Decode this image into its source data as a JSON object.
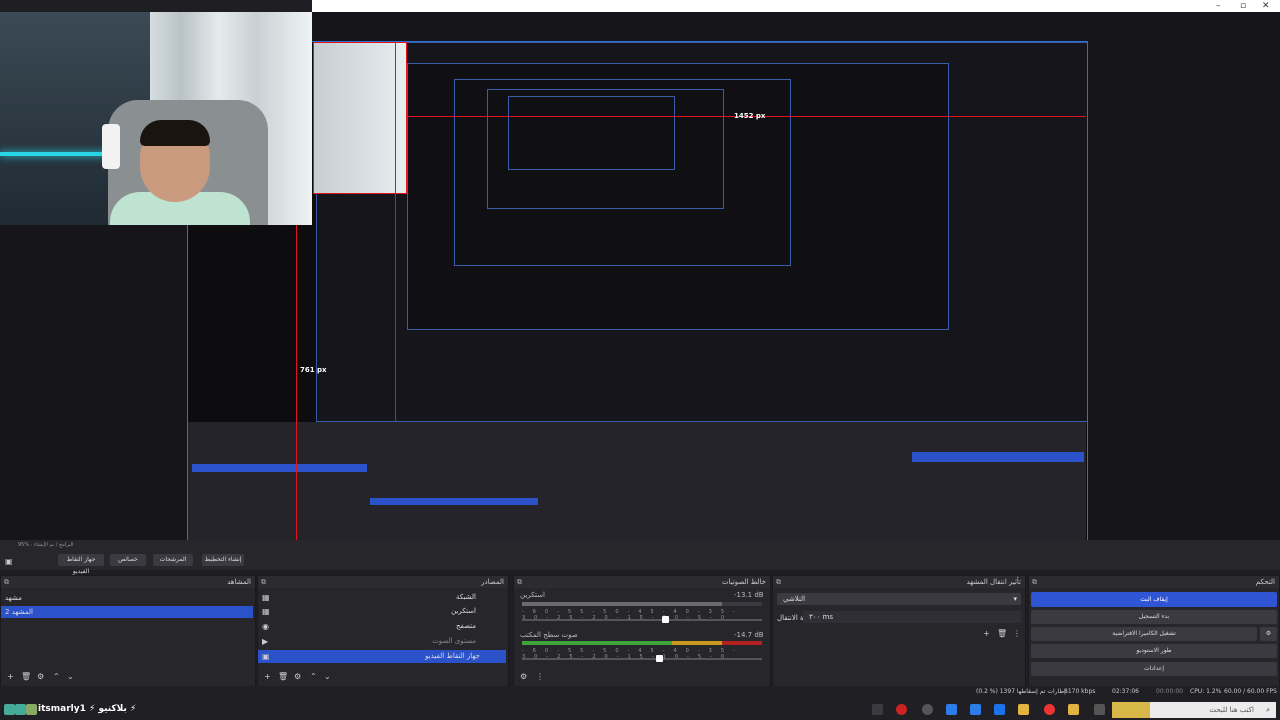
{
  "window": {
    "minimize": "–",
    "maximize": "▫",
    "close": "✕"
  },
  "preview": {
    "label_1452": "1452 px",
    "label_761": "761 px",
    "label_1452_b": "1452 px"
  },
  "topbar": {
    "version": "95% · البرامج / تم الإنشاء",
    "buttons": [
      "جهاز التقاط الفيديو",
      "خصائص",
      "المرشحات",
      "إنشاء التخطيط"
    ]
  },
  "docks": {
    "scenes": {
      "title": "المشاهد",
      "items": [
        "مشهد",
        "المشهد 2"
      ],
      "selected_index": 1
    },
    "sources": {
      "title": "المصادر",
      "items": [
        "الشبكة",
        "استكرين",
        "متصفح",
        "مستوى الصوت",
        "جهاز التقاط الفيديو"
      ],
      "selected_index": 4
    },
    "mixer": {
      "title": "خالط الصوتيات",
      "tracks": [
        {
          "name": "استكرين",
          "db": "-13.1 dB"
        },
        {
          "name": "صوت سطح المكتب",
          "db": "-14.7 dB"
        }
      ],
      "ticks": [
        "-60",
        "-55",
        "-50",
        "-45",
        "-40",
        "-35",
        "-30",
        "-25",
        "-20",
        "-15",
        "-10",
        "-5",
        "0"
      ]
    },
    "transitions": {
      "title": "تأثير انتقال المشهد",
      "selected": "التلاشي",
      "duration_label": "مدة الانتقال",
      "duration_value": "٣٠٠ ms"
    },
    "controls": {
      "title": "التحكم",
      "buttons": [
        "إيقاف البث",
        "بدء التسجيل",
        "تشغيل الكاميرا الافتراضية",
        "طور الاستوديو",
        "إعدادات"
      ]
    }
  },
  "status": {
    "dropped": "(0.2 %) 1397 إطارات تم إسقاطها",
    "kbps": "8170 kbps",
    "live_time": "02:37:06",
    "rec_time": "00:00:00",
    "cpu": "CPU: 1.2%",
    "fps": "60.00 / 60.00 FPS"
  },
  "taskbar": {
    "app_label": "itsmarly1 ⚡ بلاكنيو ⚡",
    "search_placeholder": "اكتب هنا للبحث"
  }
}
